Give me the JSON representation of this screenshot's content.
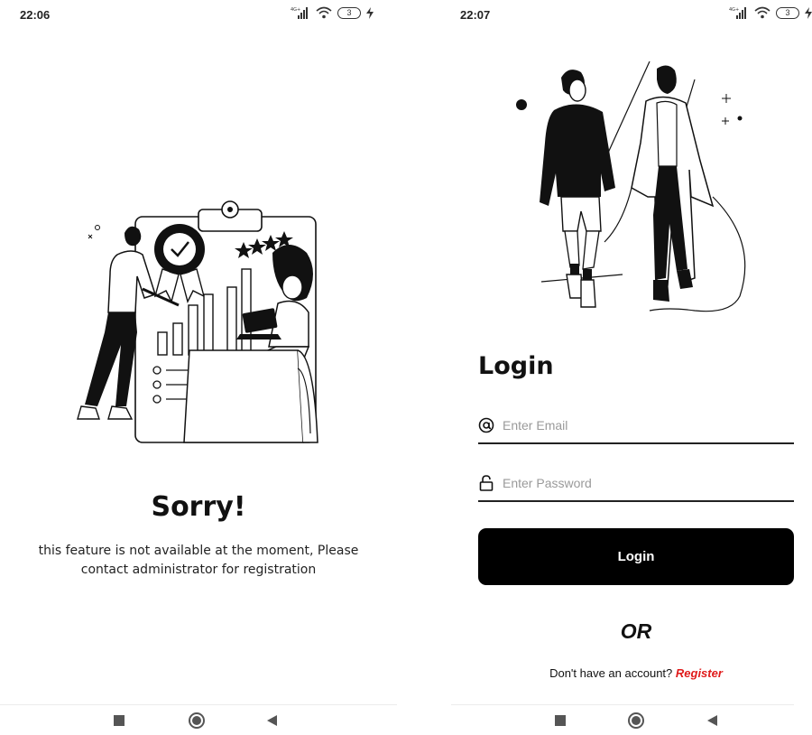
{
  "left_screen": {
    "status_time": "22:06",
    "battery_level": "3",
    "title": "Sorry!",
    "message": "this feature is not available at the moment, Please contact administrator for registration"
  },
  "right_screen": {
    "status_time": "22:07",
    "battery_level": "3",
    "title": "Login",
    "email_placeholder": "Enter Email",
    "password_placeholder": "Enter Password",
    "login_button_label": "Login",
    "or_text": "OR",
    "register_prompt": "Don't have an account? ",
    "register_link": "Register"
  },
  "icons": {
    "email": "at-sign-icon",
    "password": "lock-icon",
    "nav_recent": "square-icon",
    "nav_home": "circle-icon",
    "nav_back": "triangle-back-icon"
  },
  "colors": {
    "primary_button": "#000000",
    "register_link": "#e01b1b",
    "placeholder": "#9a9a9a"
  }
}
